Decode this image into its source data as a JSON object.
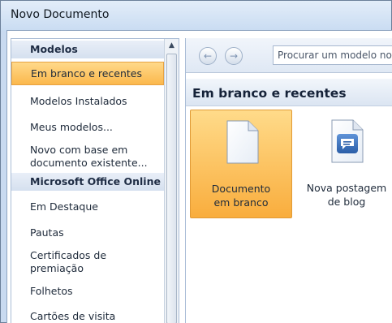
{
  "window": {
    "title": "Novo Documento"
  },
  "sidebar": {
    "header_templates": "Modelos",
    "items": [
      {
        "label": "Em branco e recentes",
        "selected": true
      },
      {
        "label": "Modelos Instalados"
      },
      {
        "label": "Meus modelos..."
      },
      {
        "label": "Novo com base em documento existente..."
      }
    ],
    "header_online": "Microsoft Office Online",
    "online_items": [
      {
        "label": "Em Destaque"
      },
      {
        "label": "Pautas"
      },
      {
        "label": "Certificados de premiação"
      },
      {
        "label": "Folhetos"
      },
      {
        "label": "Cartões de visita"
      }
    ]
  },
  "nav": {
    "back_icon": "back-arrow-icon",
    "forward_icon": "forward-arrow-icon",
    "search_placeholder": "Procurar um modelo no Microsoft Office Online"
  },
  "main": {
    "section_title": "Em branco e recentes",
    "tiles": [
      {
        "label": "Documento em branco",
        "icon": "blank-document-icon",
        "selected": true
      },
      {
        "label": "Nova postagem de blog",
        "icon": "blog-post-icon",
        "selected": false
      }
    ]
  },
  "colors": {
    "selection": "#fbb84c",
    "accent": "#2a5ea8"
  }
}
